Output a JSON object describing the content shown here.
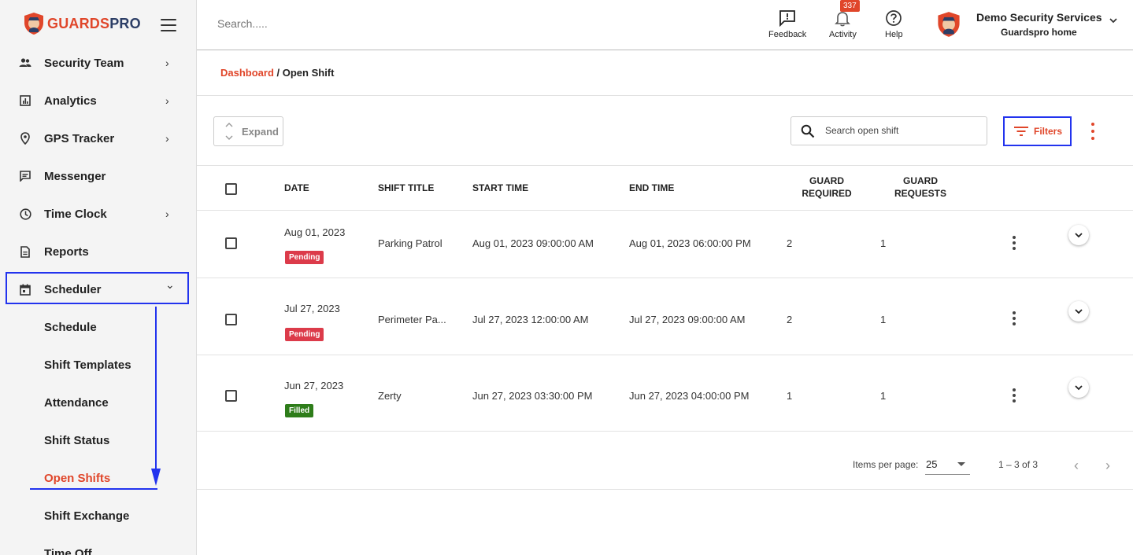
{
  "brand": {
    "name_part1": "GUARDS",
    "name_part2": "PRO",
    "accent": "#e0462a",
    "navy": "#2c3e66"
  },
  "sidebar": {
    "items": [
      {
        "label": "Security Team",
        "icon": "people-icon",
        "chevron": "›"
      },
      {
        "label": "Analytics",
        "icon": "analytics-icon",
        "chevron": "›"
      },
      {
        "label": "GPS Tracker",
        "icon": "location-pin-icon",
        "chevron": "›"
      },
      {
        "label": "Messenger",
        "icon": "chat-icon",
        "chevron": ""
      },
      {
        "label": "Time Clock",
        "icon": "clock-icon",
        "chevron": "›"
      },
      {
        "label": "Reports",
        "icon": "document-icon",
        "chevron": ""
      },
      {
        "label": "Scheduler",
        "icon": "calendar-icon",
        "chevron": "⌄"
      }
    ],
    "sub_items": [
      {
        "label": "Schedule"
      },
      {
        "label": "Shift Templates"
      },
      {
        "label": "Attendance"
      },
      {
        "label": "Shift Status"
      },
      {
        "label": "Open Shifts",
        "active": true
      },
      {
        "label": "Shift Exchange"
      },
      {
        "label": "Time Off"
      }
    ]
  },
  "header": {
    "search_placeholder": "Search.....",
    "feedback_label": "Feedback",
    "activity_label": "Activity",
    "activity_count": "337",
    "help_label": "Help",
    "user_name": "Demo Security Services",
    "user_org": "Guardspro home"
  },
  "breadcrumb": {
    "root": "Dashboard",
    "separator": " / ",
    "current": "Open Shift"
  },
  "toolbar": {
    "expand_label": "Expand",
    "search_placeholder": "Search open shift",
    "filters_label": "Filters"
  },
  "table": {
    "columns": {
      "date": "DATE",
      "shift_title": "SHIFT TITLE",
      "start_time": "START TIME",
      "end_time": "END TIME",
      "guard_required_1": "GUARD",
      "guard_required_2": "REQUIRED",
      "guard_requests_1": "GUARD",
      "guard_requests_2": "REQUESTS"
    },
    "rows": [
      {
        "date": "Aug 01, 2023",
        "status": "Pending",
        "status_type": "pending",
        "title": "Parking Patrol",
        "start": "Aug 01, 2023 09:00:00 AM",
        "end": "Aug 01, 2023 06:00:00 PM",
        "required": "2",
        "requests": "1"
      },
      {
        "date": "Jul 27, 2023",
        "status": "Pending",
        "status_type": "pending",
        "title": "Perimeter Pa...",
        "start": "Jul 27, 2023 12:00:00 AM",
        "end": "Jul 27, 2023 09:00:00 AM",
        "required": "2",
        "requests": "1"
      },
      {
        "date": "Jun 27, 2023",
        "status": "Filled",
        "status_type": "filled",
        "title": "Zerty",
        "start": "Jun 27, 2023 03:30:00 PM",
        "end": "Jun 27, 2023 04:00:00 PM",
        "required": "1",
        "requests": "1"
      }
    ]
  },
  "paginator": {
    "items_per_page_label": "Items per page:",
    "page_size": "25",
    "range": "1 – 3 of 3",
    "prev": "‹",
    "next": "›"
  },
  "status_colors": {
    "pending": "#dc3b4a",
    "filled": "#2e7d1a"
  },
  "annotation_color": "#2233ee"
}
